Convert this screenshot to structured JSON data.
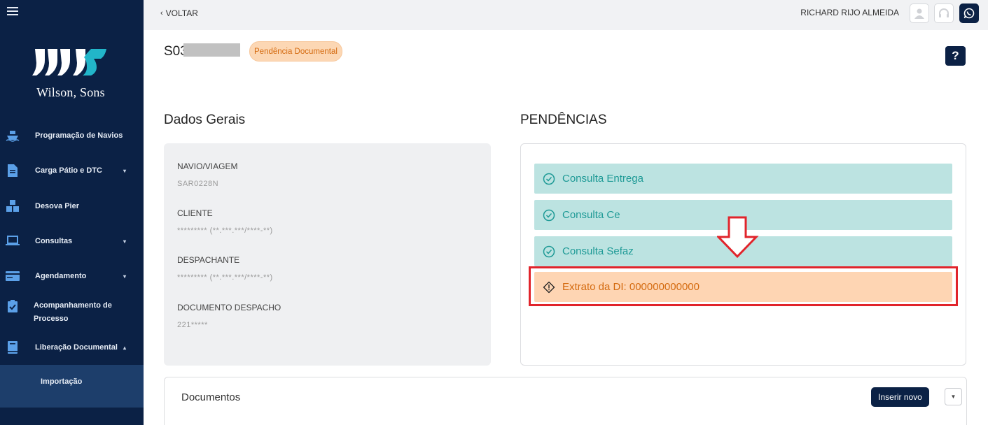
{
  "sidebar": {
    "logo_text": "Wilson, Sons",
    "items": [
      {
        "label": "Programação de Navios",
        "icon": "ship-icon",
        "caret": false
      },
      {
        "label": "Carga Pátio e DTC",
        "icon": "document-icon",
        "caret": true
      },
      {
        "label": "Desova Pier",
        "icon": "boxes-icon",
        "caret": false
      },
      {
        "label": "Consultas",
        "icon": "laptop-icon",
        "caret": true
      },
      {
        "label": "Agendamento",
        "icon": "card-icon",
        "caret": true
      },
      {
        "label": "Acompanhamento de Processo",
        "icon": "clipboard-check-icon",
        "caret": false
      },
      {
        "label": "Liberação Documental",
        "icon": "book-icon",
        "caret": true
      }
    ],
    "subitem": "Importação"
  },
  "topbar": {
    "back_label": "VOLTAR",
    "user_name": "RICHARD RIJO ALMEIDA"
  },
  "header": {
    "process_id": "S03",
    "status": "Pendência Documental",
    "help": "?"
  },
  "general": {
    "title": "Dados Gerais",
    "fields": [
      {
        "label": "NAVIO/VIAGEM",
        "value": "SAR0228N"
      },
      {
        "label": "CLIENTE",
        "value": "********* (**.***.***/****-**)"
      },
      {
        "label": "DESPACHANTE",
        "value": "********* (**.***.***/****-**)"
      },
      {
        "label": "DOCUMENTO DESPACHO",
        "value": "221*****"
      }
    ]
  },
  "pendencias": {
    "title": "PENDÊNCIAS",
    "items": [
      {
        "label": "Consulta Entrega",
        "status": "ok"
      },
      {
        "label": "Consulta Ce",
        "status": "ok"
      },
      {
        "label": "Consulta Sefaz",
        "status": "ok"
      },
      {
        "label": "Extrato da DI: 000000000000",
        "status": "warning"
      }
    ]
  },
  "documentos": {
    "title": "Documentos",
    "insert_label": "Inserir novo"
  },
  "colors": {
    "sidebar_bg": "#0b2145",
    "ok_bg": "#bce3e1",
    "ok_text": "#1e9a96",
    "warn_bg": "#fed5b3",
    "warn_text": "#d46a0f",
    "highlight": "#e1242b"
  }
}
